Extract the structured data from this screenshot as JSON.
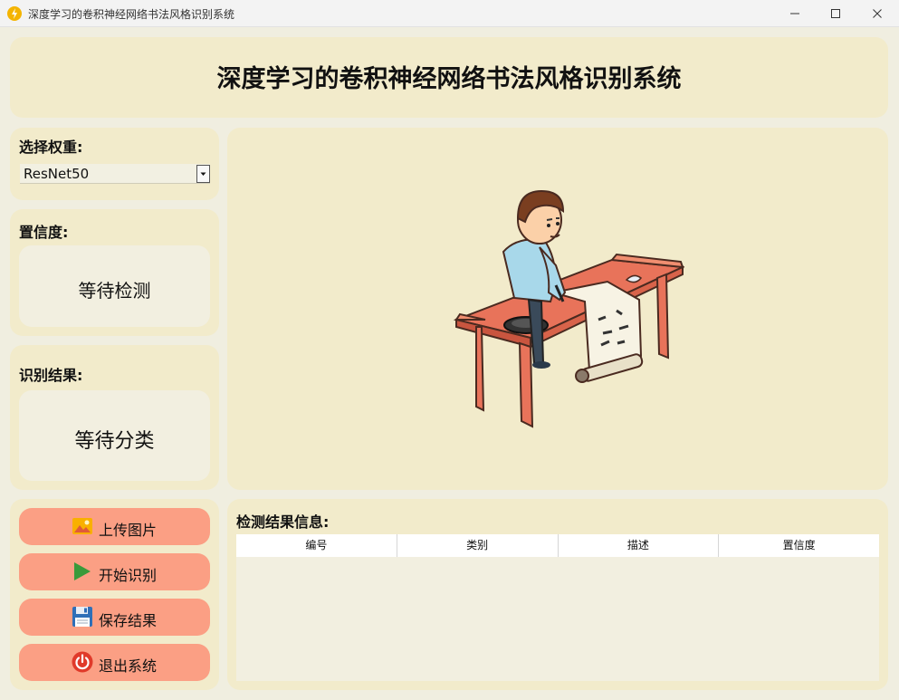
{
  "window": {
    "title": "深度学习的卷积神经网络书法风格识别系统"
  },
  "header": {
    "title": "深度学习的卷积神经网络书法风格识别系统"
  },
  "weights": {
    "label": "选择权重:",
    "selected": "ResNet50"
  },
  "confidence": {
    "label": "置信度:",
    "value": "等待检测"
  },
  "result": {
    "label": "识别结果:",
    "value": "等待分类"
  },
  "buttons": {
    "upload": "上传图片",
    "start": "开始识别",
    "save": "保存结果",
    "exit": "退出系统"
  },
  "info": {
    "label": "检测结果信息:",
    "columns": [
      "编号",
      "类别",
      "描述",
      "置信度"
    ]
  },
  "icons": {
    "app": "lightning-icon",
    "upload": "image-icon",
    "start": "play-icon",
    "save": "floppy-disk-icon",
    "exit": "power-icon"
  },
  "colors": {
    "panel": "#f2ebcb",
    "background": "#f0eee0",
    "button": "#fb9f84",
    "inner": "#f2efe0"
  }
}
